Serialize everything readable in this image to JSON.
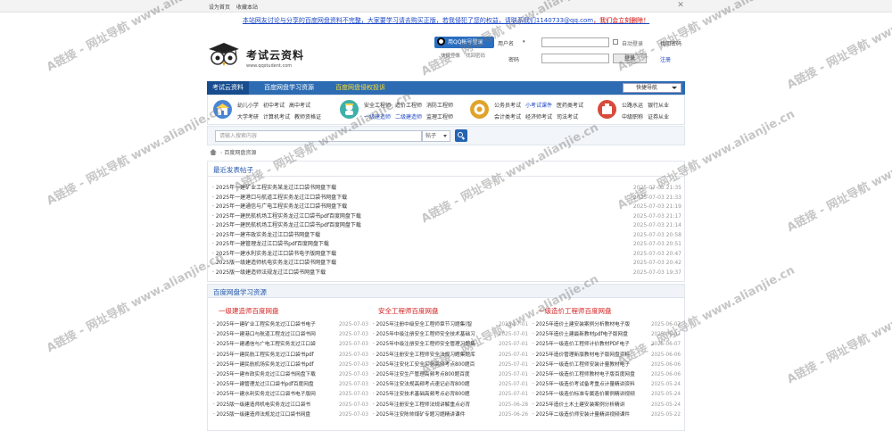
{
  "topbar": {
    "links": [
      "设为首页",
      "收藏本站"
    ],
    "close_icon": "close-icon"
  },
  "notice": {
    "text_a": "本站网友讨论与分享的百度网盘资料不完整，大家要学习请去购买正版，若我侵犯了您的权益，请联系我们",
    "contact": "1140733@qq.com",
    "text_b": "，我们会立刻删除！"
  },
  "header": {
    "logo_title": "考试云资料",
    "logo_sub": "www.qqstudent.com",
    "qq_login": "用QQ帐号登录",
    "links": [
      "快捷登录",
      "找回密码"
    ],
    "username_label": "用户名",
    "password_label": "密码",
    "auto_login": "自动登录",
    "forgot": "找回密码",
    "login_button": "登录",
    "register": "注册"
  },
  "nav": {
    "items": [
      "考试云资料",
      "百度网盘学习资源",
      "百度网盘侵权投诉"
    ],
    "quick_nav": "快捷导航"
  },
  "categories": [
    {
      "icon": "school-icon",
      "color": "#4a86d6",
      "row1": [
        "幼儿小学",
        "初中考试",
        "高中考试"
      ],
      "row2": [
        "大学考研",
        "计算机考试",
        "教师资格证"
      ]
    },
    {
      "icon": "engineer-icon",
      "color": "#3db0a8",
      "row1": [
        "安全工程师",
        "造价工程师",
        "消防工程师"
      ],
      "row2": [
        "一级建造师",
        "二级建造师",
        "监理工程师"
      ],
      "blue2": true
    },
    {
      "icon": "government-icon",
      "color": "#e0a32a",
      "row1": [
        "公务员考试",
        "小考试课件",
        "医药类考试"
      ],
      "row2": [
        "会计类考试",
        "经济师考试",
        "司法考试"
      ],
      "blue1": [
        1
      ]
    },
    {
      "icon": "finance-icon",
      "color": "#d84a3a",
      "row1": [
        "公路水运",
        "银行从业"
      ],
      "row2": [
        "中级职称",
        "证券从业"
      ]
    }
  ],
  "search": {
    "placeholder": "请输入搜索内容",
    "select_value": "帖子",
    "button_icon": "search-icon"
  },
  "breadcrumb": {
    "current": "百度网盘资源"
  },
  "recent": {
    "title": "最近发表帖子",
    "rows": [
      {
        "t": "2025年一建矿业工程实务某龙过江口袋书网盘下载",
        "d": "2025-07-03 21:35"
      },
      {
        "t": "2025年一建港口与航道工程实务龙过江口袋书网盘下载",
        "d": "2025-07-03 21:33"
      },
      {
        "t": "2025年一建通信与广电工程实务龙过江口袋书网盘下载",
        "d": "2025-07-03 21:19"
      },
      {
        "t": "2025年一建民航机场工程实务龙过江口袋书pdf百度网盘下载",
        "d": "2025-07-03 21:17"
      },
      {
        "t": "2025年一建民航机场工程实务龙过江口袋书pdf百度网盘下载",
        "d": "2025-07-03 21:14"
      },
      {
        "t": "2025年一建市政实务龙过江口袋书网盘下载",
        "d": "2025-07-03 20:58"
      },
      {
        "t": "2025年一建管理龙过江口袋书pdf百度网盘下载",
        "d": "2025-07-03 20:51"
      },
      {
        "t": "2025年一建水利实务龙过江口袋书电子版网盘下载",
        "d": "2025-07-03 20:47"
      },
      {
        "t": "2025版一级建造师机电实务龙过江口袋书网盘下载",
        "d": "2025-07-03 20:42"
      },
      {
        "t": "2025版一级建造师法规龙过江口袋书网盘下载",
        "d": "2025-07-03 19:37"
      }
    ]
  },
  "resources": {
    "title": "百度网盘学习资源",
    "columns": [
      {
        "title": "一级建造师百度网盘",
        "rows": [
          {
            "t": "2025年一建矿业工程实务龙过江口袋书电子",
            "d": "2025-07-03"
          },
          {
            "t": "2025年一建港口与航道工程龙过江口袋书网",
            "d": "2025-07-03"
          },
          {
            "t": "2025年一建通信与广电工程实务龙过江口袋",
            "d": "2025-07-03"
          },
          {
            "t": "2025年一建民航工程实务龙过江口袋书pdf",
            "d": "2025-07-03"
          },
          {
            "t": "2025年一建民航机场实务龙过江口袋书pdf",
            "d": "2025-07-03"
          },
          {
            "t": "2025年一建市政实务龙过江口袋书网盘下载",
            "d": "2025-07-03"
          },
          {
            "t": "2025年一建管理龙过江口袋书pdf百度网盘",
            "d": "2025-07-03"
          },
          {
            "t": "2025年一建水利实务龙过江口袋书电子版网",
            "d": "2025-07-03"
          },
          {
            "t": "2025版一级建造师机电实务龙过江口袋书",
            "d": "2025-07-03"
          },
          {
            "t": "2025版一级建造师法规龙过江口袋书网盘",
            "d": "2025-07-03"
          }
        ]
      },
      {
        "title": "安全工程师百度网盘",
        "rows": [
          {
            "t": "2025年注册中级安全工程师章节习题集(智",
            "d": "2025-07-01"
          },
          {
            "t": "2025年中级注册安全工程师安全技术基础习",
            "d": "2025-07-01"
          },
          {
            "t": "2025年中级注册安全工程师安全管理习题集",
            "d": "2025-07-01"
          },
          {
            "t": "2025年注册安全工程师安全法规习题集题库",
            "d": "2025-07-01"
          },
          {
            "t": "2025年注安化工安全实务高频考点800题百",
            "d": "2025-07-01"
          },
          {
            "t": "2025年注安生产管理高频考点800题百度",
            "d": "2025-07-01"
          },
          {
            "t": "2025年注安法规高频考点速记必背800题",
            "d": "2025-07-01"
          },
          {
            "t": "2025年注安技术基础高频考点必背800题",
            "d": "2025-07-01"
          },
          {
            "t": "2025年注册安全工程师法规讲解重点必背",
            "d": "2025-06-28"
          },
          {
            "t": "2025年注安陈帅煤矿专题习题精讲课件",
            "d": "2025-06-26"
          }
        ]
      },
      {
        "title": "一级造价工程师百度网盘",
        "rows": [
          {
            "t": "2025年造价土建安装案例分析教材电子版",
            "d": "2025-06-07"
          },
          {
            "t": "2025年造价土建最新教材pdf电子版网盘",
            "d": "2025-06-07"
          },
          {
            "t": "2025年一级造价工程师计价教材PDF电子",
            "d": "2025-06-07"
          },
          {
            "t": "2025年造价管理新版教材电子版网盘资料",
            "d": "2025-06-06"
          },
          {
            "t": "2025年一级造价工程师安装计量教材电子",
            "d": "2025-06-06"
          },
          {
            "t": "2025年一级造价工程师教材电子版百度网盘",
            "d": "2025-06-06"
          },
          {
            "t": "2025年一级造价考试备考重点计量精讲资料",
            "d": "2025-05-24"
          },
          {
            "t": "2025年一级造价标准专属造价案例精讲视频",
            "d": "2025-05-24"
          },
          {
            "t": "2025年造价土木土建安装案例分析精讲",
            "d": "2025-05-24"
          },
          {
            "t": "2025年二级造价师安装计量精讲视频课件",
            "d": "2025-05-22"
          }
        ]
      }
    ]
  },
  "watermark": "A链接 - 网址导航 www.alianjie.cn"
}
